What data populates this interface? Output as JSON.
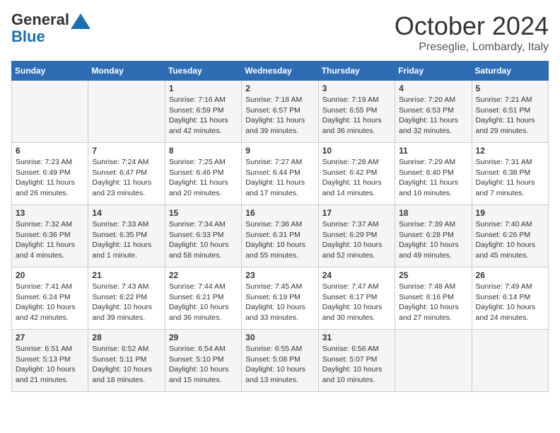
{
  "header": {
    "logo_line1": "General",
    "logo_line2": "Blue",
    "month": "October 2024",
    "location": "Preseglie, Lombardy, Italy"
  },
  "days_of_week": [
    "Sunday",
    "Monday",
    "Tuesday",
    "Wednesday",
    "Thursday",
    "Friday",
    "Saturday"
  ],
  "weeks": [
    [
      {
        "day": "",
        "detail": ""
      },
      {
        "day": "",
        "detail": ""
      },
      {
        "day": "1",
        "detail": "Sunrise: 7:16 AM\nSunset: 6:59 PM\nDaylight: 11 hours and 42 minutes."
      },
      {
        "day": "2",
        "detail": "Sunrise: 7:18 AM\nSunset: 6:57 PM\nDaylight: 11 hours and 39 minutes."
      },
      {
        "day": "3",
        "detail": "Sunrise: 7:19 AM\nSunset: 6:55 PM\nDaylight: 11 hours and 36 minutes."
      },
      {
        "day": "4",
        "detail": "Sunrise: 7:20 AM\nSunset: 6:53 PM\nDaylight: 11 hours and 32 minutes."
      },
      {
        "day": "5",
        "detail": "Sunrise: 7:21 AM\nSunset: 6:51 PM\nDaylight: 11 hours and 29 minutes."
      }
    ],
    [
      {
        "day": "6",
        "detail": "Sunrise: 7:23 AM\nSunset: 6:49 PM\nDaylight: 11 hours and 26 minutes."
      },
      {
        "day": "7",
        "detail": "Sunrise: 7:24 AM\nSunset: 6:47 PM\nDaylight: 11 hours and 23 minutes."
      },
      {
        "day": "8",
        "detail": "Sunrise: 7:25 AM\nSunset: 6:46 PM\nDaylight: 11 hours and 20 minutes."
      },
      {
        "day": "9",
        "detail": "Sunrise: 7:27 AM\nSunset: 6:44 PM\nDaylight: 11 hours and 17 minutes."
      },
      {
        "day": "10",
        "detail": "Sunrise: 7:28 AM\nSunset: 6:42 PM\nDaylight: 11 hours and 14 minutes."
      },
      {
        "day": "11",
        "detail": "Sunrise: 7:29 AM\nSunset: 6:40 PM\nDaylight: 11 hours and 10 minutes."
      },
      {
        "day": "12",
        "detail": "Sunrise: 7:31 AM\nSunset: 6:38 PM\nDaylight: 11 hours and 7 minutes."
      }
    ],
    [
      {
        "day": "13",
        "detail": "Sunrise: 7:32 AM\nSunset: 6:36 PM\nDaylight: 11 hours and 4 minutes."
      },
      {
        "day": "14",
        "detail": "Sunrise: 7:33 AM\nSunset: 6:35 PM\nDaylight: 11 hours and 1 minute."
      },
      {
        "day": "15",
        "detail": "Sunrise: 7:34 AM\nSunset: 6:33 PM\nDaylight: 10 hours and 58 minutes."
      },
      {
        "day": "16",
        "detail": "Sunrise: 7:36 AM\nSunset: 6:31 PM\nDaylight: 10 hours and 55 minutes."
      },
      {
        "day": "17",
        "detail": "Sunrise: 7:37 AM\nSunset: 6:29 PM\nDaylight: 10 hours and 52 minutes."
      },
      {
        "day": "18",
        "detail": "Sunrise: 7:39 AM\nSunset: 6:28 PM\nDaylight: 10 hours and 49 minutes."
      },
      {
        "day": "19",
        "detail": "Sunrise: 7:40 AM\nSunset: 6:26 PM\nDaylight: 10 hours and 45 minutes."
      }
    ],
    [
      {
        "day": "20",
        "detail": "Sunrise: 7:41 AM\nSunset: 6:24 PM\nDaylight: 10 hours and 42 minutes."
      },
      {
        "day": "21",
        "detail": "Sunrise: 7:43 AM\nSunset: 6:22 PM\nDaylight: 10 hours and 39 minutes."
      },
      {
        "day": "22",
        "detail": "Sunrise: 7:44 AM\nSunset: 6:21 PM\nDaylight: 10 hours and 36 minutes."
      },
      {
        "day": "23",
        "detail": "Sunrise: 7:45 AM\nSunset: 6:19 PM\nDaylight: 10 hours and 33 minutes."
      },
      {
        "day": "24",
        "detail": "Sunrise: 7:47 AM\nSunset: 6:17 PM\nDaylight: 10 hours and 30 minutes."
      },
      {
        "day": "25",
        "detail": "Sunrise: 7:48 AM\nSunset: 6:16 PM\nDaylight: 10 hours and 27 minutes."
      },
      {
        "day": "26",
        "detail": "Sunrise: 7:49 AM\nSunset: 6:14 PM\nDaylight: 10 hours and 24 minutes."
      }
    ],
    [
      {
        "day": "27",
        "detail": "Sunrise: 6:51 AM\nSunset: 5:13 PM\nDaylight: 10 hours and 21 minutes."
      },
      {
        "day": "28",
        "detail": "Sunrise: 6:52 AM\nSunset: 5:11 PM\nDaylight: 10 hours and 18 minutes."
      },
      {
        "day": "29",
        "detail": "Sunrise: 6:54 AM\nSunset: 5:10 PM\nDaylight: 10 hours and 15 minutes."
      },
      {
        "day": "30",
        "detail": "Sunrise: 6:55 AM\nSunset: 5:08 PM\nDaylight: 10 hours and 13 minutes."
      },
      {
        "day": "31",
        "detail": "Sunrise: 6:56 AM\nSunset: 5:07 PM\nDaylight: 10 hours and 10 minutes."
      },
      {
        "day": "",
        "detail": ""
      },
      {
        "day": "",
        "detail": ""
      }
    ]
  ]
}
